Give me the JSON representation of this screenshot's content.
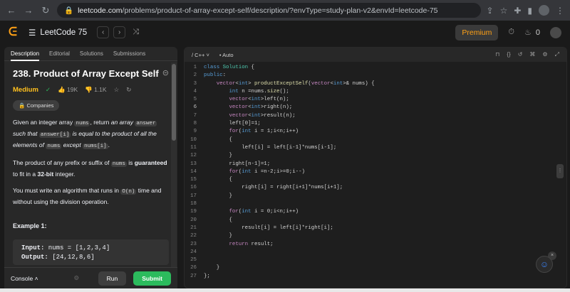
{
  "browser": {
    "url_host": "leetcode.com",
    "url_path": "/problems/product-of-array-except-self/description/?envType=study-plan-v2&envId=leetcode-75"
  },
  "header": {
    "list_name": "LeetCode 75",
    "premium_label": "Premium",
    "streak_count": "0"
  },
  "left_tabs": [
    "Description",
    "Editorial",
    "Solutions",
    "Submissions"
  ],
  "problem": {
    "title": "238. Product of Array Except Self",
    "difficulty": "Medium",
    "likes": "19K",
    "dislikes": "1.1K",
    "companies_label": "Companies",
    "p1": [
      {
        "t": "Given an integer array "
      },
      {
        "code": "nums"
      },
      {
        "t": ", return "
      },
      {
        "i": "an array "
      },
      {
        "code": "answer"
      },
      {
        "i": " such that "
      },
      {
        "code": "answer[i]"
      },
      {
        "i": " is equal to the product of all the elements of "
      },
      {
        "code": "nums"
      },
      {
        "i": " except "
      },
      {
        "code": "nums[i]"
      },
      {
        "t": "."
      }
    ],
    "p2": [
      {
        "t": "The product of any prefix or suffix of "
      },
      {
        "code": "nums"
      },
      {
        "t": " is "
      },
      {
        "b": "guaranteed"
      },
      {
        "t": " to fit in a "
      },
      {
        "b": "32-bit"
      },
      {
        "t": " integer."
      }
    ],
    "p3": [
      {
        "t": "You must write an algorithm that runs in "
      },
      {
        "code": "O(n)"
      },
      {
        "t": " time and without using the division operation."
      }
    ],
    "example_title": "Example 1:",
    "example_input_label": "Input:",
    "example_input_value": " nums = [1,2,3,4]",
    "example_output_label": "Output:",
    "example_output_value": " [24,12,8,6]"
  },
  "bottom": {
    "console_label": "Console",
    "run_label": "Run",
    "submit_label": "Submit"
  },
  "editor": {
    "language": "C++",
    "mode": "Auto",
    "current_line": 6,
    "code_lines": [
      "class Solution {",
      "public:",
      "    vector<int> productExceptSelf(vector<int>& nums) {",
      "        int n =nums.size();",
      "        vector<int>left(n);",
      "        vector<int>right(n);",
      "        vector<int>result(n);",
      "        left[0]=1;",
      "        for(int i = 1;i<n;i++)",
      "        {",
      "            left[i] = left[i-1]*nums[i-1];",
      "        }",
      "        right[n-1]=1;",
      "        for(int i =n-2;i>=0;i--)",
      "        {",
      "            right[i] = right[i+1]*nums[i+1];",
      "        }",
      "",
      "        for(int i = 0;i<n;i++)",
      "        {",
      "            result[i] = left[i]*right[i];",
      "        }",
      "        return result;",
      "",
      "",
      "    }",
      "};"
    ]
  }
}
